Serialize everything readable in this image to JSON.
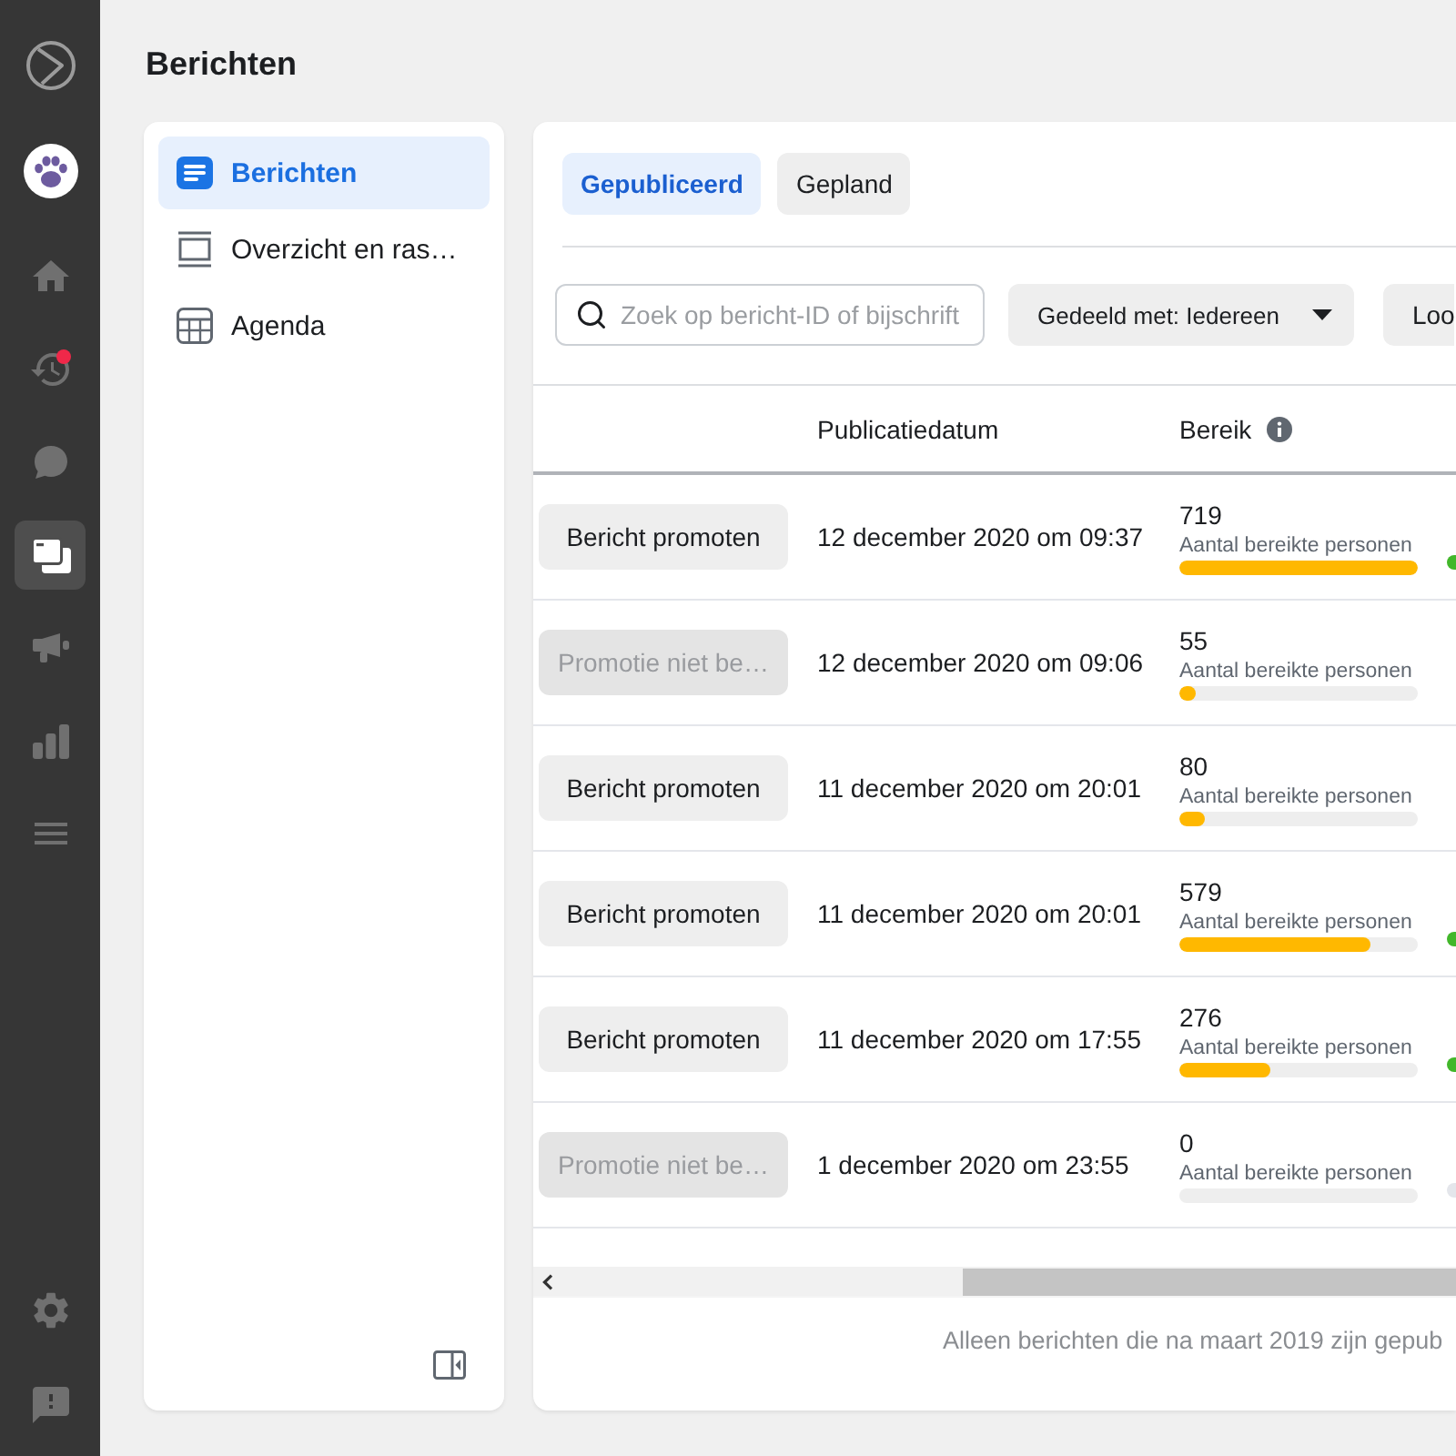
{
  "rail": {
    "items": [
      {
        "selected": false,
        "alert": false
      },
      {
        "selected": false,
        "alert": true
      },
      {
        "selected": false,
        "alert": false
      },
      {
        "selected": true,
        "alert": false
      },
      {
        "selected": false,
        "alert": false
      },
      {
        "selected": false,
        "alert": false
      },
      {
        "selected": false,
        "alert": false
      }
    ]
  },
  "page_title": "Berichten",
  "sidebar": {
    "items": [
      {
        "label": "Berichten",
        "selected": true
      },
      {
        "label": "Overzicht en ras…",
        "selected": false
      },
      {
        "label": "Agenda",
        "selected": false
      }
    ]
  },
  "tabs": [
    {
      "label": "Gepubliceerd",
      "selected": true
    },
    {
      "label": "Gepland",
      "selected": false
    }
  ],
  "filters": {
    "search": {
      "placeholder": "Zoek op bericht-ID of bijschrift"
    },
    "dropdown": {
      "label": "Gedeeld met: Iedereen"
    },
    "button": {
      "label": "Loo"
    }
  },
  "table": {
    "columns": [
      {
        "label": "Publicatiedatum"
      },
      {
        "label": "Bereik"
      }
    ],
    "rows": [
      {
        "action": {
          "label": "Bericht promoten",
          "disabled": false
        },
        "date": "12 december 2020 om 09:37",
        "reach": {
          "value": "719",
          "caption": "Aantal bereikte personen",
          "level": 1
        },
        "column_4": {
          "color": "#42b72a"
        }
      },
      {
        "action": {
          "label": "Promotie niet be…",
          "disabled": true
        },
        "date": "12 december 2020 om 09:06",
        "reach": {
          "value": "55",
          "caption": "Aantal bereikte personen",
          "level": 0.07
        }
      },
      {
        "action": {
          "label": "Bericht promoten",
          "disabled": false
        },
        "date": "11 december 2020 om 20:01",
        "reach": {
          "value": "80",
          "caption": "Aantal bereikte personen",
          "level": 0.11
        }
      },
      {
        "action": {
          "label": "Bericht promoten",
          "disabled": false
        },
        "date": "11 december 2020 om 20:01",
        "reach": {
          "value": "579",
          "caption": "Aantal bereikte personen",
          "level": 0.8
        },
        "column_4": {
          "color": "#42b72a"
        }
      },
      {
        "action": {
          "label": "Bericht promoten",
          "disabled": false
        },
        "date": "11 december 2020 om 17:55",
        "reach": {
          "value": "276",
          "caption": "Aantal bereikte personen",
          "level": 0.38
        },
        "column_4": {
          "color": "#42b72a"
        }
      },
      {
        "action": {
          "label": "Promotie niet be…",
          "disabled": true
        },
        "date": "1 december 2020 om 23:55",
        "reach": {
          "value": "0",
          "caption": "Aantal bereikte personen",
          "level": 0
        },
        "column_4": {
          "color": "#e4e6eb"
        }
      }
    ]
  },
  "footer_note": "Alleen berichten die na maart 2019 zijn gepub"
}
